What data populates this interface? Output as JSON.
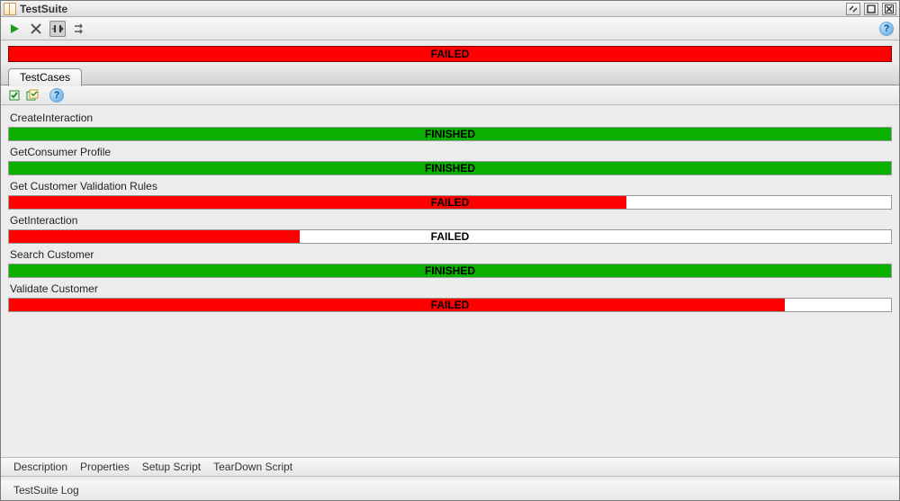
{
  "window": {
    "title": "TestSuite"
  },
  "summary": {
    "status": "FAILED",
    "color": "#f00",
    "fill": 100
  },
  "tabs": {
    "main": "TestCases"
  },
  "cases": [
    {
      "name": "CreateInteraction",
      "status": "FINISHED",
      "color": "green",
      "fill": 100
    },
    {
      "name": "GetConsumer Profile",
      "status": "FINISHED",
      "color": "green",
      "fill": 100
    },
    {
      "name": "Get Customer Validation Rules",
      "status": "FAILED",
      "color": "red",
      "fill": 70
    },
    {
      "name": "GetInteraction",
      "status": "FAILED",
      "color": "red",
      "fill": 33
    },
    {
      "name": "Search Customer",
      "status": "FINISHED",
      "color": "green",
      "fill": 100
    },
    {
      "name": "Validate Customer",
      "status": "FAILED",
      "color": "red",
      "fill": 88
    }
  ],
  "bottom_tabs": [
    "Description",
    "Properties",
    "Setup Script",
    "TearDown Script"
  ],
  "log": {
    "label": "TestSuite Log"
  }
}
